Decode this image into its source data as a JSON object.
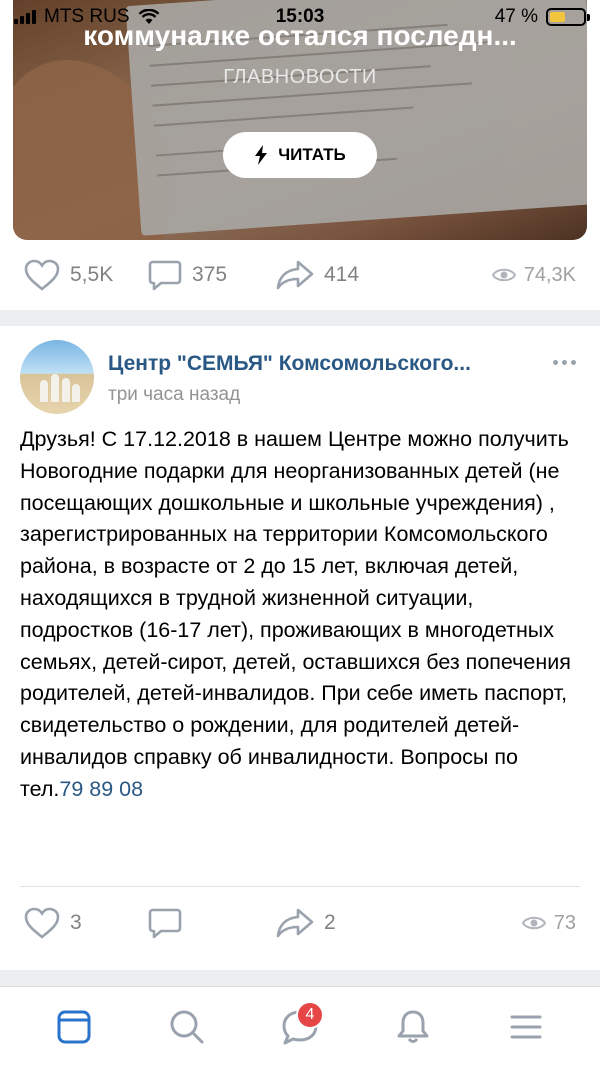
{
  "status_bar": {
    "carrier": "MTS RUS",
    "time": "15:03",
    "battery": "47 %",
    "battery_level": 0.47
  },
  "article": {
    "title": "коммуналке остался последн...",
    "source": "ГЛАВНОВОСТИ",
    "read_label": "ЧИТАТЬ"
  },
  "first_post_actions": {
    "likes": "5,5K",
    "comments": "375",
    "shares": "414",
    "views": "74,3K"
  },
  "post": {
    "group_name": "Центр \"СЕМЬЯ\" Комсомольского...",
    "time": "три часа назад",
    "text": "Друзья! С 17.12.2018 в нашем Центре можно получить Новогодние подарки для неорганизованных детей (не посещающих дошкольные и школьные учреждения) , зарегистрированных на территории Комсомольского района, в возрасте от 2 до 15 лет, включая детей, находящихся в трудной жизненной ситуации, подростков (16-17 лет), проживающих в многодетных семьях, детей-сирот, детей, оставшихся без попечения родителей, детей-инвалидов. При себе иметь паспорт, свидетельство о рождении, для родителей детей-инвалидов справку об инвалидности. Вопросы по тел.",
    "phone": "79 89 08",
    "likes": "3",
    "comments": "",
    "shares": "2",
    "views": "73"
  },
  "tab_bar": {
    "messages_badge": "4"
  },
  "colors": {
    "link": "#2a5885",
    "badge": "#e64646",
    "active_tab": "#2a73cc",
    "icon_gray": "#99a2ad"
  }
}
